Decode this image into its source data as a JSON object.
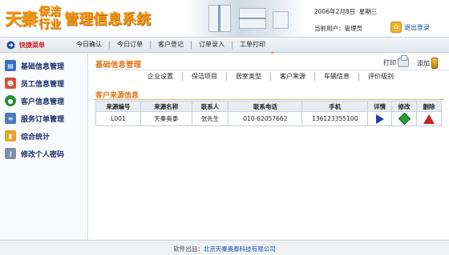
{
  "header": {
    "logo_main": "天秦",
    "logo_stack": [
      "保洁",
      "行业"
    ],
    "logo_sub": "管理信息系统",
    "date": "2006年2月8日",
    "weekday": "星期三",
    "user_label": "当前用户：",
    "user_name": "管理员",
    "logout_label": "退出登录"
  },
  "navbar": {
    "quick_label": "快捷菜单",
    "items": [
      "今日确认",
      "今日订单",
      "客户登记",
      "订单录入",
      "工单打印"
    ]
  },
  "sidebar": {
    "items": [
      {
        "label": "基础信息管理",
        "icon": "book-icon"
      },
      {
        "label": "员工信息管理",
        "icon": "people-icon"
      },
      {
        "label": "客户信息管理",
        "icon": "globe-icon"
      },
      {
        "label": "服务订单管理",
        "icon": "document-icon"
      },
      {
        "label": "综合统计",
        "icon": "bar-chart-icon"
      },
      {
        "label": "修改个人密码",
        "icon": "key-icon"
      }
    ]
  },
  "main": {
    "panel_title": "基础信息管理",
    "print_label": "打印",
    "add_label": "添加",
    "subtabs": [
      "企业设置",
      "保洁项目",
      "居室类型",
      "客户来源",
      "车辆信息",
      "评价级别"
    ],
    "section_title": "客户来源信息",
    "table": {
      "headers": [
        "来源编号",
        "来源名称",
        "联系人",
        "联系电话",
        "手机",
        "详情",
        "修改",
        "删除"
      ],
      "rows": [
        {
          "id": "L001",
          "name": "天秦奥泰",
          "contact": "张先生",
          "phone": "010-62057662",
          "mobile": "136123355100"
        }
      ]
    }
  },
  "footer": {
    "prefix": "软件出品：",
    "company": "北京天秦奥泰科技有限公司"
  },
  "colors": {
    "brand_orange": "#e2751b",
    "nav_blue": "#1d2f6c",
    "link_blue": "#1b4fa5"
  }
}
